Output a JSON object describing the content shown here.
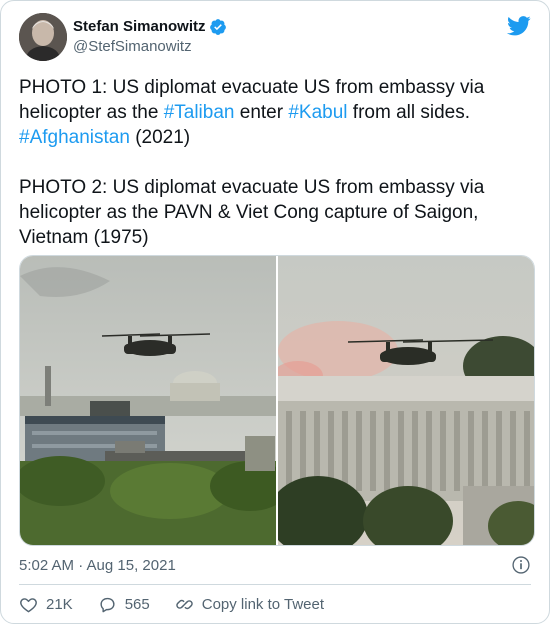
{
  "author": {
    "display_name": "Stefan Simanowitz",
    "handle": "@StefSimanowitz"
  },
  "icons": {
    "avatar": "avatar-photo",
    "verified": "verified-badge-icon",
    "brand": "twitter-bird-icon",
    "info": "info-icon",
    "like": "heart-icon",
    "reply": "reply-bubble-icon",
    "share": "link-icon"
  },
  "colors": {
    "accent": "#1d9bf0",
    "text": "#0f1419",
    "muted": "#536471",
    "border": "#cfd9de"
  },
  "tweet": {
    "para1": {
      "t1": "PHOTO 1: US diplomat evacuate US from embassy via helicopter as the ",
      "h1": "#Taliban",
      "t2": " enter ",
      "h2": "#Kabul",
      "t3": " from all sides.",
      "h3": "#Afghanistan",
      "t4": " (2021)"
    },
    "para2": "PHOTO 2: US diplomat evacuate US from embassy via helicopter as the PAVN & Viet Cong capture of Saigon, Vietnam (1975)"
  },
  "footer": {
    "timestamp": "5:02 AM · Aug 15, 2021",
    "likes": "21K",
    "replies": "565",
    "copy_link": "Copy link to Tweet"
  }
}
